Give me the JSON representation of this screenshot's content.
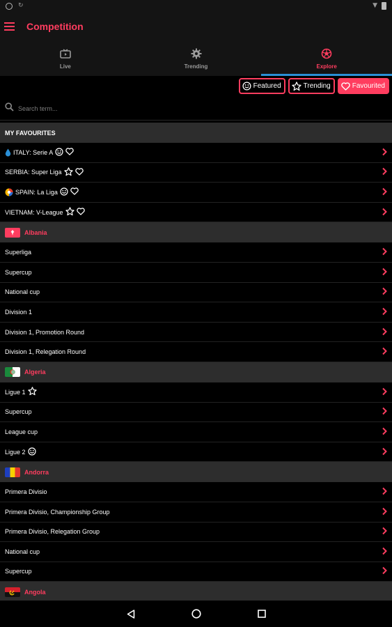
{
  "app": {
    "title": "Competition"
  },
  "colors": {
    "accent": "#ff3d5f",
    "tab_indicator": "#2a8fd6",
    "section_bg": "#2d2d2d"
  },
  "tabs": [
    {
      "label": "Live",
      "icon": "tv-icon"
    },
    {
      "label": "Trending",
      "icon": "trophy-icon"
    },
    {
      "label": "Explore",
      "icon": "soccer-ball-icon",
      "active": true
    }
  ],
  "filters": [
    {
      "label": "Featured",
      "icon": "smile-icon",
      "active": false
    },
    {
      "label": "Trending",
      "icon": "star-icon",
      "active": false
    },
    {
      "label": "Favourited",
      "icon": "heart-icon",
      "active": true
    }
  ],
  "search": {
    "placeholder": "Search term..."
  },
  "favourites": {
    "header": "MY FAVOURITES",
    "items": [
      {
        "label": "ITALY: Serie A",
        "lead_icon": "drop-icon",
        "icons": [
          "smile-icon",
          "heart-icon"
        ]
      },
      {
        "label": "SERBIA: Super Liga",
        "icons": [
          "star-icon",
          "heart-icon"
        ]
      },
      {
        "label": "SPAIN: La Liga",
        "lead_icon": "laliga-logo-icon",
        "icons": [
          "smile-icon",
          "heart-icon"
        ]
      },
      {
        "label": "VIETNAM: V-League",
        "icons": [
          "star-icon",
          "heart-icon"
        ]
      }
    ]
  },
  "countries": [
    {
      "name": "Albania",
      "flag": "albania-flag",
      "items": [
        "Superliga",
        "Supercup",
        "National cup",
        "Division 1",
        "Division 1, Promotion Round",
        "Division 1, Relegation Round"
      ]
    },
    {
      "name": "Algeria",
      "flag": "algeria-flag",
      "items": [
        "Ligue 1",
        "Supercup",
        "League cup",
        "Ligue 2"
      ]
    },
    {
      "name": "Andorra",
      "flag": "andorra-flag",
      "items": [
        "Primera Divisio",
        "Primera Divisio, Championship Group",
        "Primera Divisio, Relegation Group",
        "National cup",
        "Supercup"
      ]
    },
    {
      "name": "Angola",
      "flag": "angola-flag",
      "items": []
    }
  ]
}
